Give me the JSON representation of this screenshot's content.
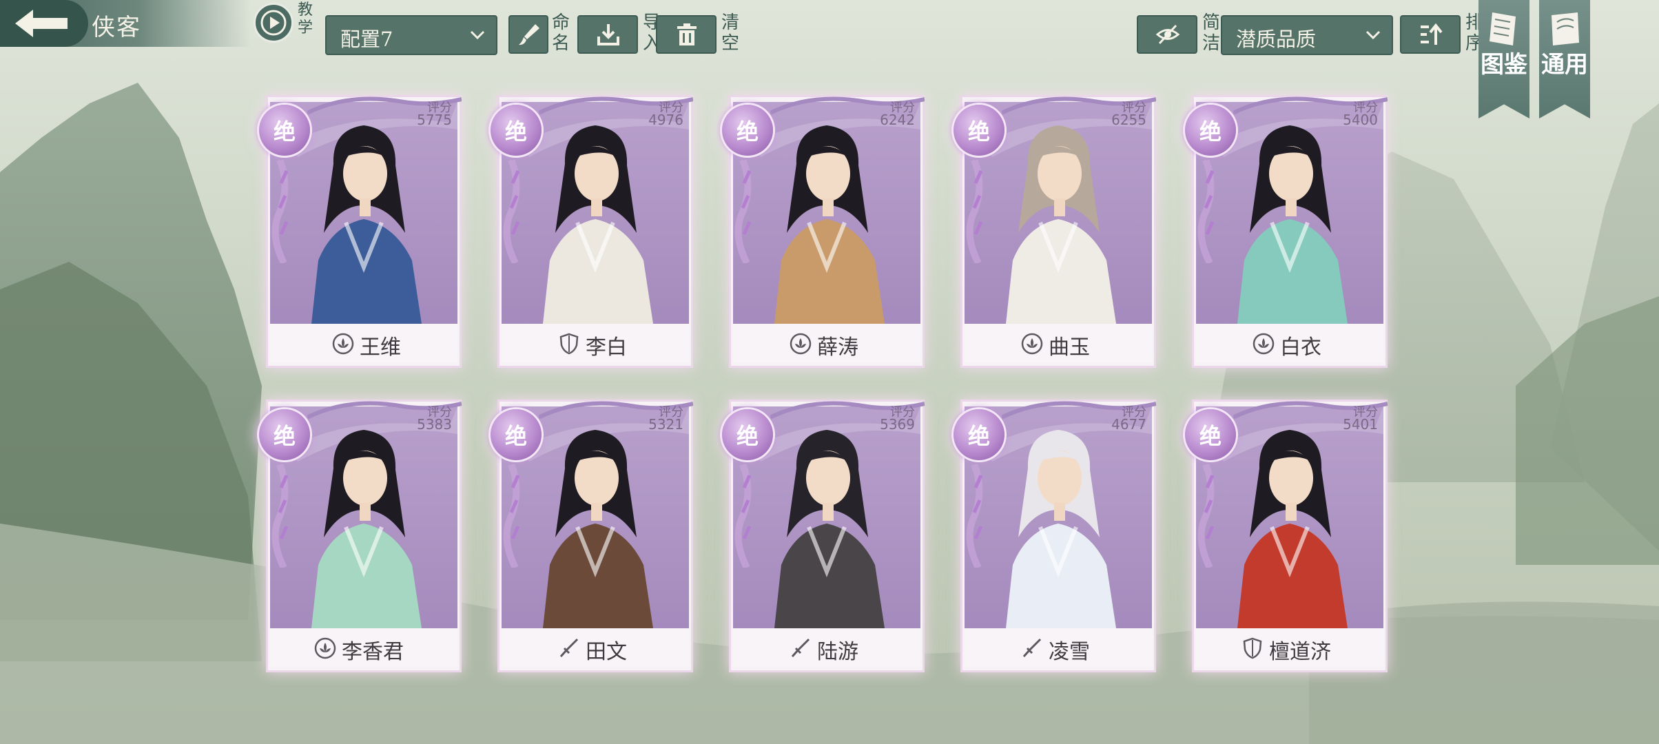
{
  "header": {
    "title": "侠客",
    "tutorial_label": "教学",
    "config_select": "配置7",
    "rename_label": "命名",
    "import_label": "导入",
    "clear_label": "清空",
    "simple_label": "简洁",
    "sort_select": "潜质品质",
    "sort_label": "排序"
  },
  "banners": {
    "codex_label": "图鉴",
    "general_label": "通用"
  },
  "score_label": "评分",
  "heroes": [
    {
      "grade": "绝",
      "name": "王维",
      "score": "5775",
      "class_icon": "lotus-icon"
    },
    {
      "grade": "绝",
      "name": "李白",
      "score": "4976",
      "class_icon": "shield-icon"
    },
    {
      "grade": "绝",
      "name": "薛涛",
      "score": "6242",
      "class_icon": "lotus-icon"
    },
    {
      "grade": "绝",
      "name": "曲玉",
      "score": "6255",
      "class_icon": "lotus-icon"
    },
    {
      "grade": "绝",
      "name": "白衣",
      "score": "5400",
      "class_icon": "lotus-icon"
    },
    {
      "grade": "绝",
      "name": "李香君",
      "score": "5383",
      "class_icon": "lotus-icon"
    },
    {
      "grade": "绝",
      "name": "田文",
      "score": "5321",
      "class_icon": "sword-icon"
    },
    {
      "grade": "绝",
      "name": "陆游",
      "score": "5369",
      "class_icon": "sword-icon"
    },
    {
      "grade": "绝",
      "name": "凌雪",
      "score": "4677",
      "class_icon": "sword-icon"
    },
    {
      "grade": "绝",
      "name": "檀道济",
      "score": "5401",
      "class_icon": "shield-icon"
    }
  ],
  "colors": {
    "ui_green": "#557369",
    "card_purple": "#a58bbd",
    "grade_purple": "#b98bcf"
  }
}
